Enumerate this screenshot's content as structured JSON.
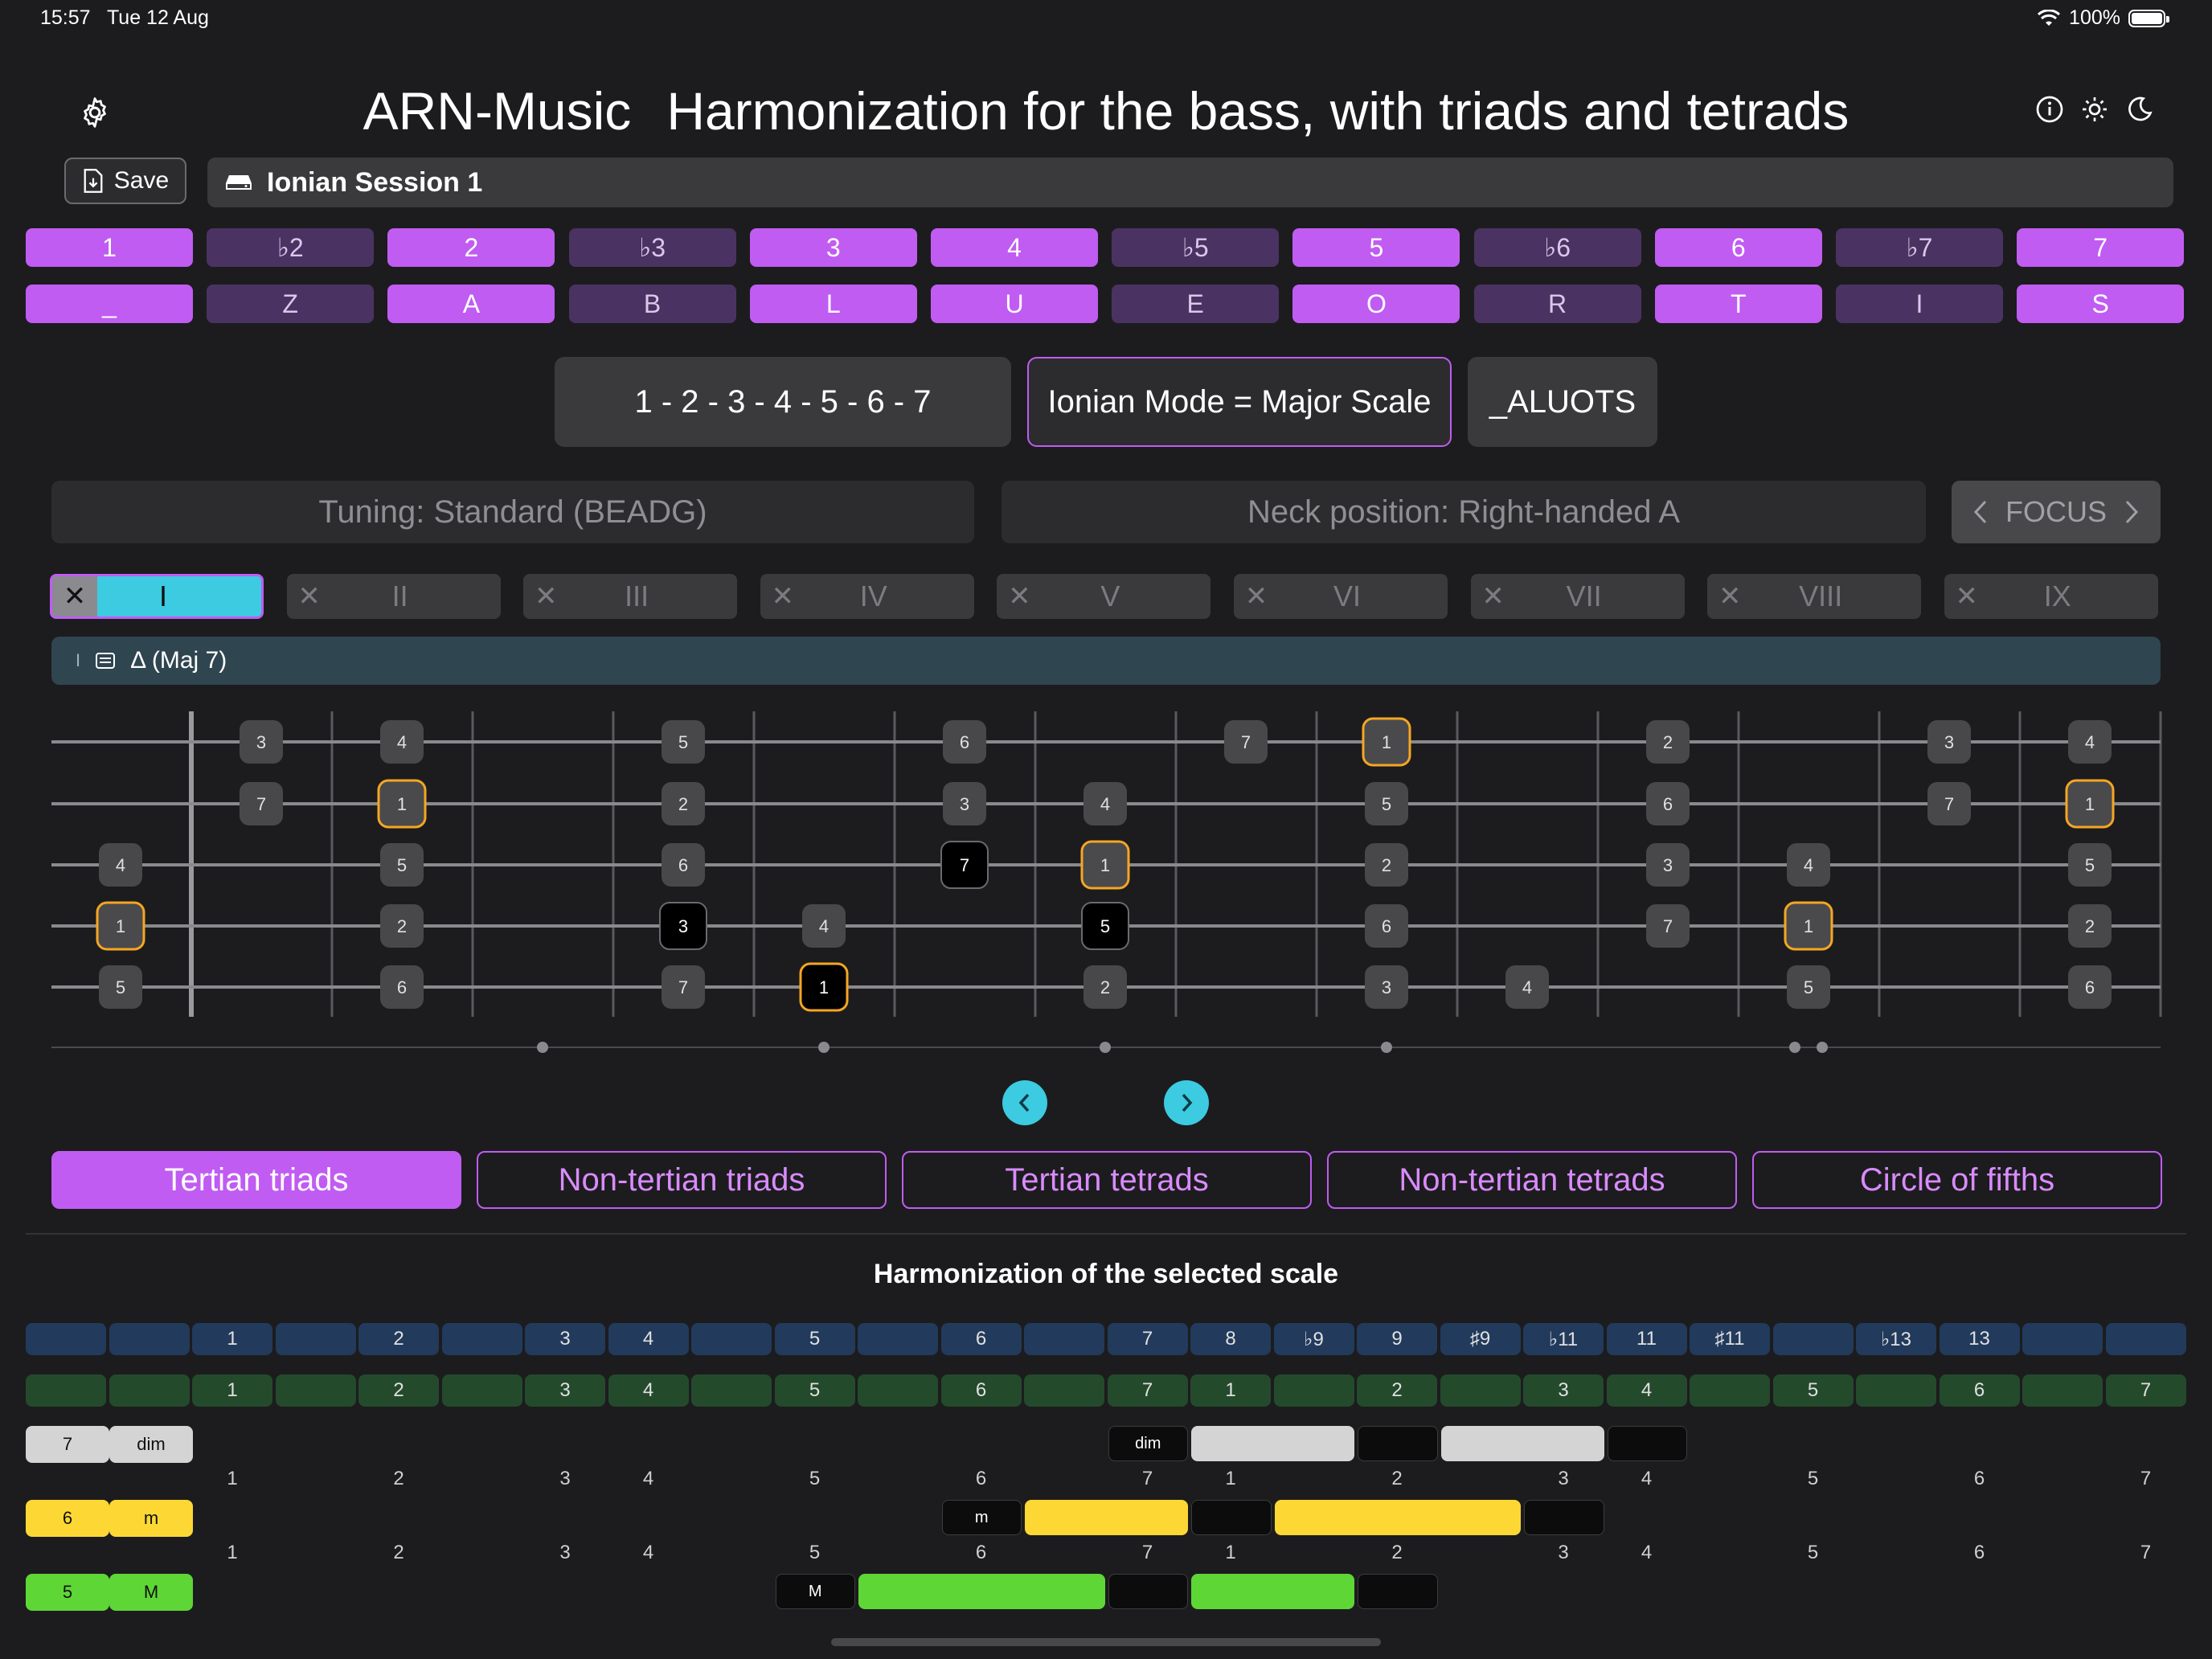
{
  "status": {
    "time": "15:57",
    "date": "Tue 12 Aug",
    "battery": "100%"
  },
  "header": {
    "app_name": "ARN-Music",
    "subtitle": "Harmonization for the bass, with triads and tetrads"
  },
  "toolbar": {
    "save_label": "Save",
    "session_name": "Ionian Session 1"
  },
  "intervals": {
    "degrees": [
      {
        "label": "1",
        "on": true
      },
      {
        "label": "♭2",
        "on": false
      },
      {
        "label": "2",
        "on": true
      },
      {
        "label": "♭3",
        "on": false
      },
      {
        "label": "3",
        "on": true
      },
      {
        "label": "4",
        "on": true
      },
      {
        "label": "♭5",
        "on": false
      },
      {
        "label": "5",
        "on": true
      },
      {
        "label": "♭6",
        "on": false
      },
      {
        "label": "6",
        "on": true
      },
      {
        "label": "♭7",
        "on": false
      },
      {
        "label": "7",
        "on": true
      }
    ],
    "letters": [
      "_",
      "Z",
      "A",
      "B",
      "L",
      "U",
      "E",
      "O",
      "R",
      "T",
      "I",
      "S"
    ]
  },
  "scale": {
    "formula": "1 - 2 - 3 - 4 - 5 - 6 - 7",
    "mode": "Ionian Mode = Major Scale",
    "code": "_ALUOTS"
  },
  "settings": {
    "tuning": "Tuning: Standard (BEADG)",
    "neck": "Neck position: Right-handed A",
    "focus": "FOCUS"
  },
  "chord_tabs": [
    "I",
    "II",
    "III",
    "IV",
    "V",
    "VI",
    "VII",
    "VIII",
    "IX"
  ],
  "selected_chord": {
    "roman": "I",
    "name": "Δ (Maj 7)"
  },
  "fretboard": {
    "notes": [
      {
        "s": 0,
        "f": 1,
        "t": "3"
      },
      {
        "s": 0,
        "f": 2,
        "t": "4"
      },
      {
        "s": 0,
        "f": 4,
        "t": "5"
      },
      {
        "s": 0,
        "f": 6,
        "t": "6"
      },
      {
        "s": 0,
        "f": 8,
        "t": "7"
      },
      {
        "s": 0,
        "f": 9,
        "t": "1",
        "k": "root"
      },
      {
        "s": 0,
        "f": 11,
        "t": "2"
      },
      {
        "s": 0,
        "f": 13,
        "t": "3"
      },
      {
        "s": 0,
        "f": 14,
        "t": "4"
      },
      {
        "s": 1,
        "f": 1,
        "t": "7"
      },
      {
        "s": 1,
        "f": 2,
        "t": "1",
        "k": "root"
      },
      {
        "s": 1,
        "f": 4,
        "t": "2"
      },
      {
        "s": 1,
        "f": 6,
        "t": "3"
      },
      {
        "s": 1,
        "f": 7,
        "t": "4"
      },
      {
        "s": 1,
        "f": 9,
        "t": "5"
      },
      {
        "s": 1,
        "f": 11,
        "t": "6"
      },
      {
        "s": 1,
        "f": 13,
        "t": "7"
      },
      {
        "s": 1,
        "f": 14,
        "t": "1",
        "k": "root"
      },
      {
        "s": 2,
        "f": 0,
        "t": "4"
      },
      {
        "s": 2,
        "f": 2,
        "t": "5"
      },
      {
        "s": 2,
        "f": 4,
        "t": "6"
      },
      {
        "s": 2,
        "f": 6,
        "t": "7",
        "k": "chord"
      },
      {
        "s": 2,
        "f": 7,
        "t": "1",
        "k": "root"
      },
      {
        "s": 2,
        "f": 9,
        "t": "2"
      },
      {
        "s": 2,
        "f": 11,
        "t": "3"
      },
      {
        "s": 2,
        "f": 12,
        "t": "4"
      },
      {
        "s": 2,
        "f": 14,
        "t": "5"
      },
      {
        "s": 3,
        "f": 0,
        "t": "1",
        "k": "root"
      },
      {
        "s": 3,
        "f": 2,
        "t": "2"
      },
      {
        "s": 3,
        "f": 4,
        "t": "3",
        "k": "chord"
      },
      {
        "s": 3,
        "f": 5,
        "t": "4"
      },
      {
        "s": 3,
        "f": 7,
        "t": "5",
        "k": "chord"
      },
      {
        "s": 3,
        "f": 9,
        "t": "6"
      },
      {
        "s": 3,
        "f": 11,
        "t": "7"
      },
      {
        "s": 3,
        "f": 12,
        "t": "1",
        "k": "root"
      },
      {
        "s": 3,
        "f": 14,
        "t": "2"
      },
      {
        "s": 4,
        "f": 0,
        "t": "5"
      },
      {
        "s": 4,
        "f": 2,
        "t": "6"
      },
      {
        "s": 4,
        "f": 4,
        "t": "7"
      },
      {
        "s": 4,
        "f": 5,
        "t": "1",
        "k": "rootblk"
      },
      {
        "s": 4,
        "f": 7,
        "t": "2"
      },
      {
        "s": 4,
        "f": 9,
        "t": "3"
      },
      {
        "s": 4,
        "f": 10,
        "t": "4"
      },
      {
        "s": 4,
        "f": 12,
        "t": "5"
      },
      {
        "s": 4,
        "f": 14,
        "t": "6"
      }
    ]
  },
  "bottom_tabs": [
    {
      "label": "Tertian triads",
      "selected": true
    },
    {
      "label": "Non-tertian triads",
      "selected": false
    },
    {
      "label": "Tertian tetrads",
      "selected": false
    },
    {
      "label": "Non-tertian tetrads",
      "selected": false
    },
    {
      "label": "Circle of fifths",
      "selected": false
    }
  ],
  "harmonization": {
    "title": "Harmonization of the selected scale",
    "interval_row": [
      "",
      "",
      "1",
      "",
      "2",
      "",
      "3",
      "4",
      "",
      "5",
      "",
      "6",
      "",
      "7",
      "8",
      "♭9",
      "9",
      "♯9",
      "♭11",
      "11",
      "♯11",
      "",
      "♭13",
      "13",
      "",
      ""
    ],
    "degree_row": [
      "",
      "",
      "1",
      "",
      "2",
      "",
      "3",
      "4",
      "",
      "5",
      "",
      "6",
      "",
      "7",
      "1",
      "",
      "2",
      "",
      "3",
      "4",
      "",
      "5",
      "",
      "6",
      "",
      "7"
    ],
    "number_row": [
      "1",
      "2",
      "3",
      "4",
      "5",
      "6",
      "7",
      "1",
      "2",
      "3",
      "4",
      "5",
      "6",
      "7"
    ],
    "rows": [
      {
        "degree": "7",
        "quality": "dim",
        "chord_label": "dim",
        "color": "#d4d4d4"
      },
      {
        "degree": "6",
        "quality": "m",
        "chord_label": "m",
        "color": "#fdd835"
      },
      {
        "degree": "5",
        "quality": "M",
        "chord_label": "M",
        "color": "#5ed636"
      }
    ]
  },
  "colors": {
    "accent": "#c05cf2",
    "accent_dim": "#4a3362",
    "cyan": "#3ccbe0",
    "root": "#f5a623"
  }
}
